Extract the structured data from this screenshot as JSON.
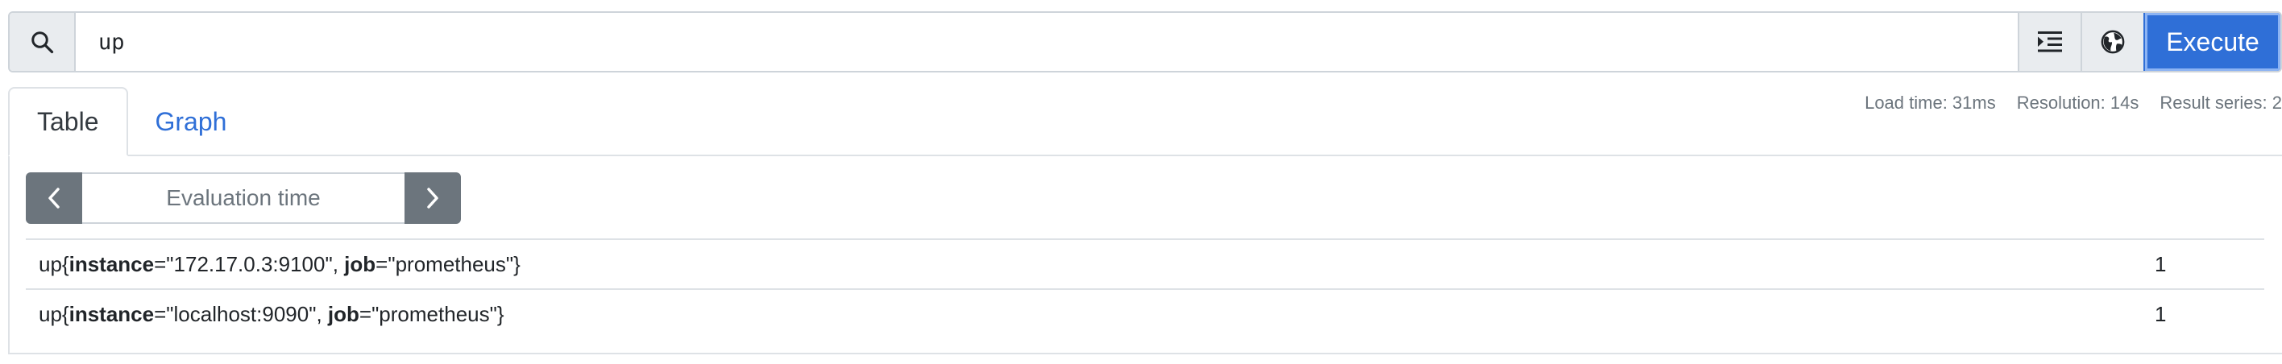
{
  "query": {
    "search_icon": "magnifier-icon",
    "expression": "up",
    "format_icon": "indent-icon",
    "explore_icon": "globe-icon",
    "execute_label": "Execute"
  },
  "tabs": [
    {
      "label": "Table",
      "active": true
    },
    {
      "label": "Graph",
      "active": false
    }
  ],
  "stats": {
    "load_time": "Load time: 31ms",
    "resolution": "Resolution: 14s",
    "result_series": "Result series: 2"
  },
  "eval": {
    "prev_icon": "chevron-left-icon",
    "placeholder": "Evaluation time",
    "next_icon": "chevron-right-icon"
  },
  "results": [
    {
      "metric": "up",
      "open": "{",
      "labels": [
        {
          "key": "instance",
          "eq": "=",
          "value": "\"172.17.0.3:9100\"",
          "sep": ", "
        },
        {
          "key": "job",
          "eq": "=",
          "value": "\"prometheus\"",
          "sep": ""
        }
      ],
      "close": "}",
      "value": "1"
    },
    {
      "metric": "up",
      "open": "{",
      "labels": [
        {
          "key": "instance",
          "eq": "=",
          "value": "\"localhost:9090\"",
          "sep": ", "
        },
        {
          "key": "job",
          "eq": "=",
          "value": "\"prometheus\"",
          "sep": ""
        }
      ],
      "close": "}",
      "value": "1"
    }
  ],
  "colors": {
    "primary": "#2f6fd7",
    "secondary": "#6c757d",
    "border": "#dee2e6"
  }
}
